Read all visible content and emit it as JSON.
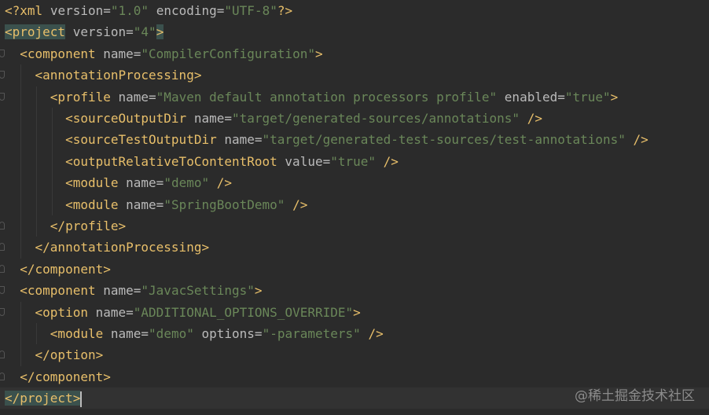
{
  "editor": {
    "language": "XML",
    "lines": [
      {
        "text": "<?xml version=\"1.0\" encoding=\"UTF-8\"?>"
      },
      {
        "text": "<project version=\"4\">"
      },
      {
        "text": "  <component name=\"CompilerConfiguration\">"
      },
      {
        "text": "    <annotationProcessing>"
      },
      {
        "text": "      <profile name=\"Maven default annotation processors profile\" enabled=\"true\">"
      },
      {
        "text": "        <sourceOutputDir name=\"target/generated-sources/annotations\" />"
      },
      {
        "text": "        <sourceTestOutputDir name=\"target/generated-test-sources/test-annotations\" />"
      },
      {
        "text": "        <outputRelativeToContentRoot value=\"true\" />"
      },
      {
        "text": "        <module name=\"demo\" />"
      },
      {
        "text": "        <module name=\"SpringBootDemo\" />"
      },
      {
        "text": "      </profile>"
      },
      {
        "text": "    </annotationProcessing>"
      },
      {
        "text": "  </component>"
      },
      {
        "text": "  <component name=\"JavacSettings\">"
      },
      {
        "text": "    <option name=\"ADDITIONAL_OPTIONS_OVERRIDE\">"
      },
      {
        "text": "      <module name=\"demo\" options=\"-parameters\" />"
      },
      {
        "text": "    </option>"
      },
      {
        "text": "  </component>"
      },
      {
        "text": "</project>"
      }
    ],
    "fold_markers": [
      {
        "line": 2,
        "kind": "start"
      },
      {
        "line": 3,
        "kind": "start"
      },
      {
        "line": 4,
        "kind": "start"
      },
      {
        "line": 10,
        "kind": "end"
      },
      {
        "line": 11,
        "kind": "end"
      },
      {
        "line": 12,
        "kind": "end"
      },
      {
        "line": 13,
        "kind": "start"
      },
      {
        "line": 14,
        "kind": "start"
      },
      {
        "line": 16,
        "kind": "end"
      },
      {
        "line": 17,
        "kind": "end"
      }
    ],
    "current_line": 18,
    "matched_tag_lines": [
      1,
      18
    ]
  },
  "watermark": {
    "text": "@稀土掘金技术社区"
  },
  "colors": {
    "background": "#2b2b2b",
    "current_line": "#323232",
    "tag": "#e8bf6a",
    "attribute": "#bababa",
    "value": "#6a8759",
    "text": "#a9b7c6",
    "tag_match_highlight": "#3b514d"
  }
}
